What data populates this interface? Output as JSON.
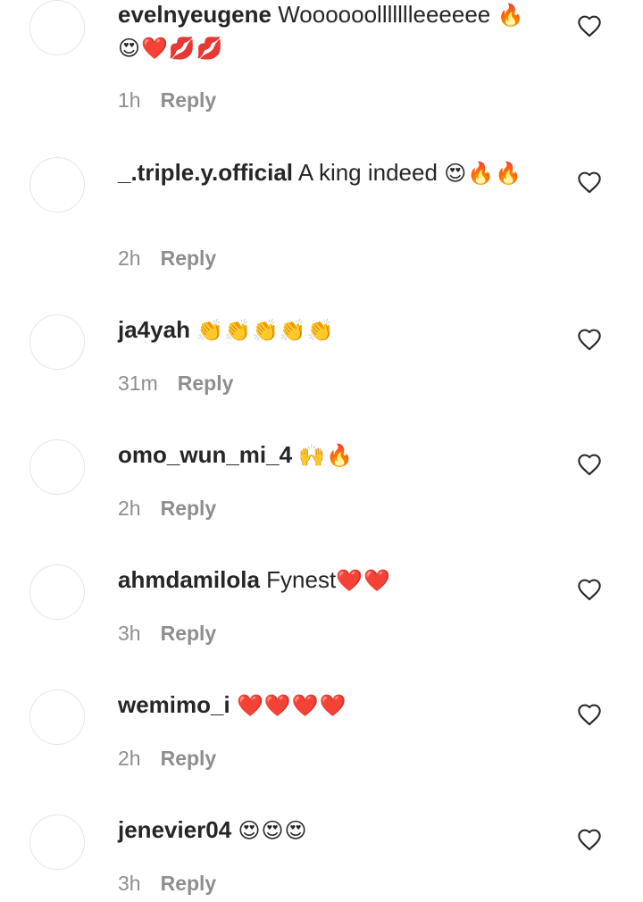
{
  "comments": [
    {
      "username": "evelnyeugene",
      "text": "Woooooollllllleeeeee",
      "emojis": "🔥😍❤️💋💋",
      "time": "1h",
      "reply": "Reply"
    },
    {
      "username": "_.triple.y.official",
      "text": "A king indeed",
      "emojis": "😍🔥🔥",
      "time": "2h",
      "reply": "Reply"
    },
    {
      "username": "ja4yah",
      "text": "",
      "emojis": "👏👏👏👏👏",
      "time": "31m",
      "reply": "Reply"
    },
    {
      "username": "omo_wun_mi_4",
      "text": "",
      "emojis": "🙌🔥",
      "time": "2h",
      "reply": "Reply"
    },
    {
      "username": "ahmdamilola",
      "text": "Fynest",
      "emojis": "❤️❤️",
      "time": "3h",
      "reply": "Reply"
    },
    {
      "username": "wemimo_i",
      "text": "",
      "emojis": "❤️❤️❤️❤️",
      "time": "2h",
      "reply": "Reply"
    },
    {
      "username": "jenevier04",
      "text": "",
      "emojis": "😍😍😍",
      "time": "3h",
      "reply": "Reply"
    }
  ],
  "icons": {
    "like": "heart-outline-icon"
  },
  "colors": {
    "text": "#262626",
    "secondary": "#8e8e8e",
    "avatar_border": "#e6e6e6"
  }
}
